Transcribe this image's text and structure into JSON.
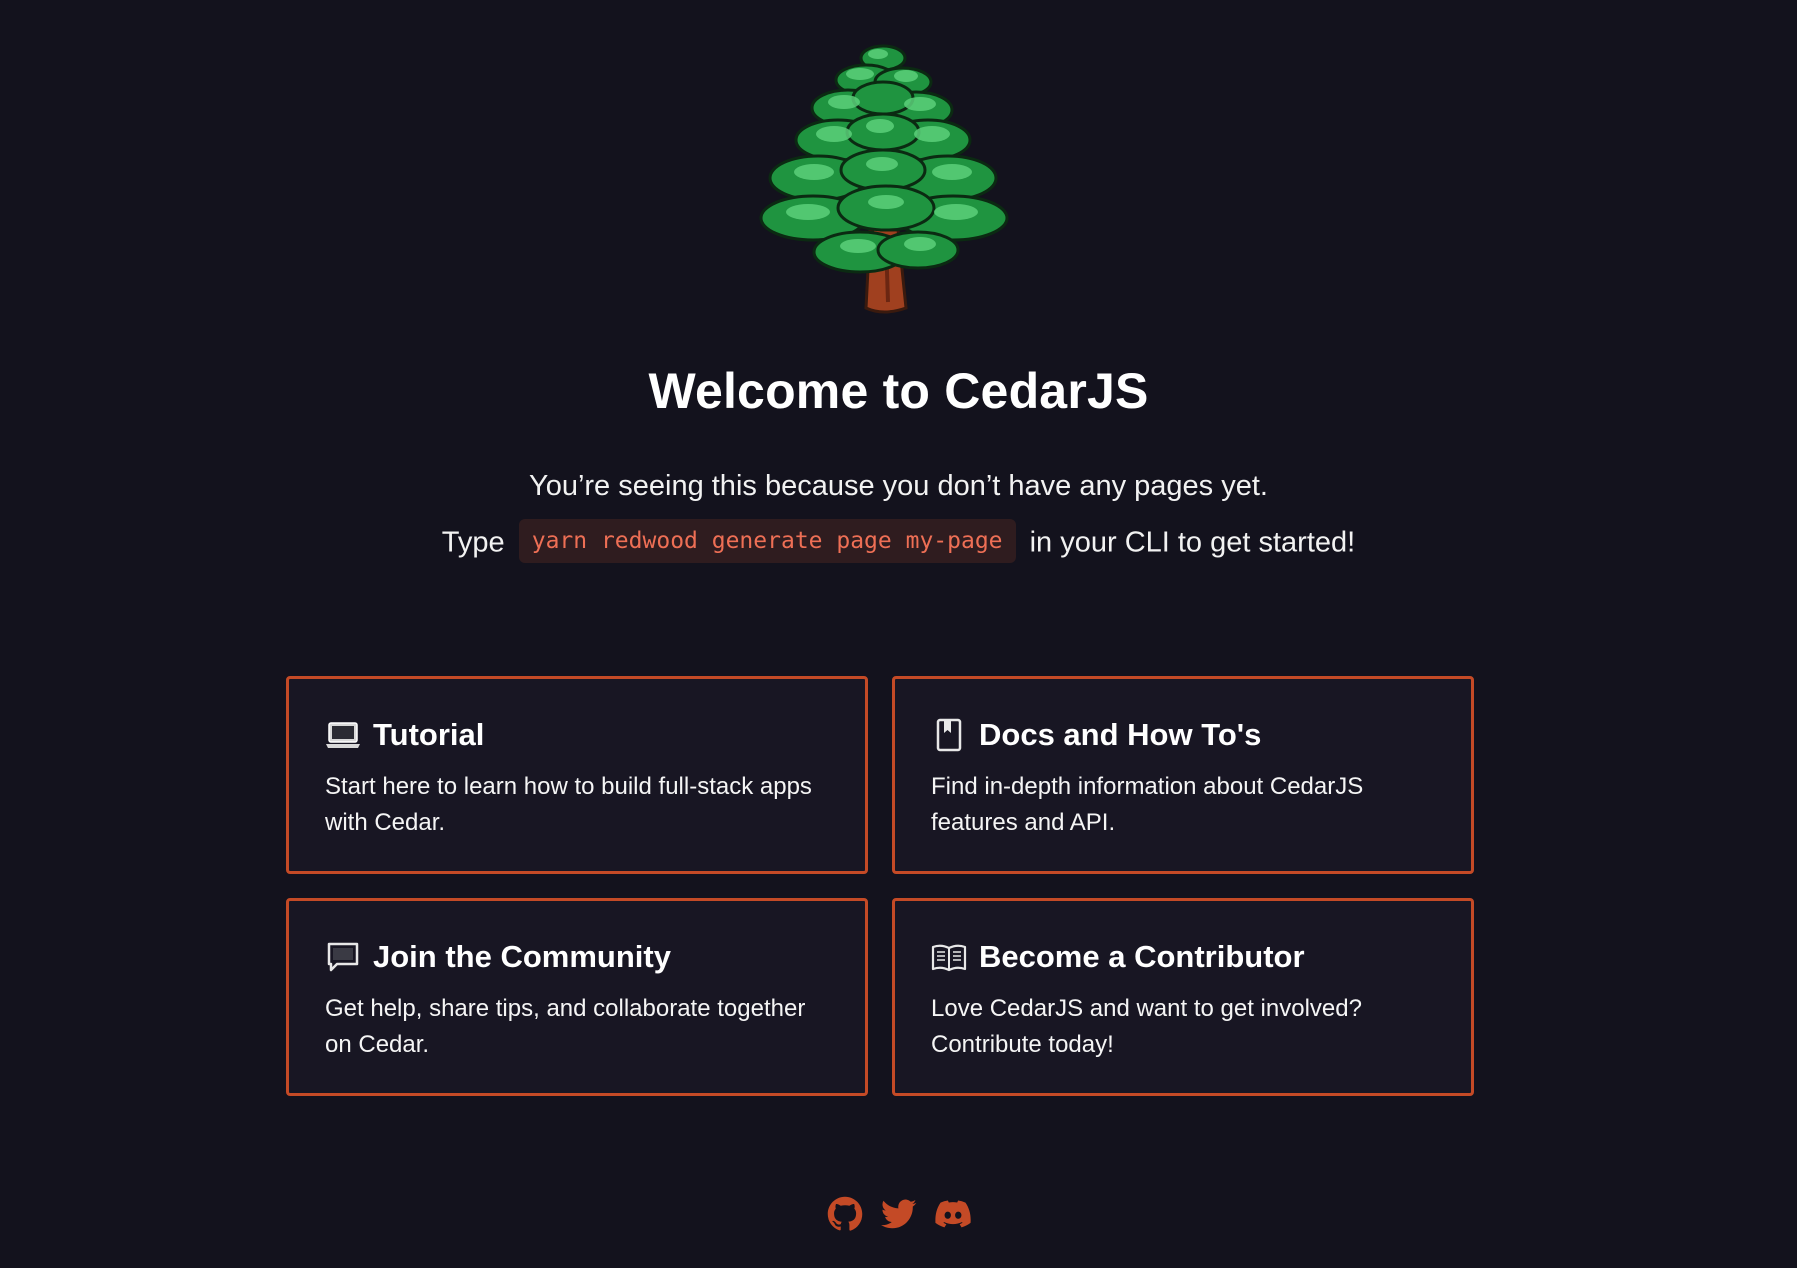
{
  "header": {
    "logo_icon": "evergreen-tree-icon",
    "title": "Welcome to CedarJS",
    "subtitle": "You’re seeing this because you don’t have any pages yet.",
    "cmd_prefix": "Type",
    "command": "yarn redwood generate page my-page",
    "cmd_suffix": "in your CLI to get started!"
  },
  "cards": [
    {
      "icon": "laptop-icon",
      "title": "Tutorial",
      "desc": "Start here to learn how to build full-stack apps with Cedar."
    },
    {
      "icon": "bookmark-icon",
      "title": "Docs and How To's",
      "desc": "Find in-depth information about CedarJS features and API."
    },
    {
      "icon": "speech-bubble-icon",
      "title": "Join the Community",
      "desc": "Get help, share tips, and collaborate together on Cedar."
    },
    {
      "icon": "open-book-icon",
      "title": "Become a Contributor",
      "desc": "Love CedarJS and want to get involved? Contribute today!"
    }
  ],
  "social": [
    {
      "icon": "github-icon"
    },
    {
      "icon": "twitter-icon"
    },
    {
      "icon": "discord-icon"
    }
  ],
  "colors": {
    "background": "#13121d",
    "card_background": "#181623",
    "accent": "#c44a26",
    "command_text": "#ee6f55"
  }
}
